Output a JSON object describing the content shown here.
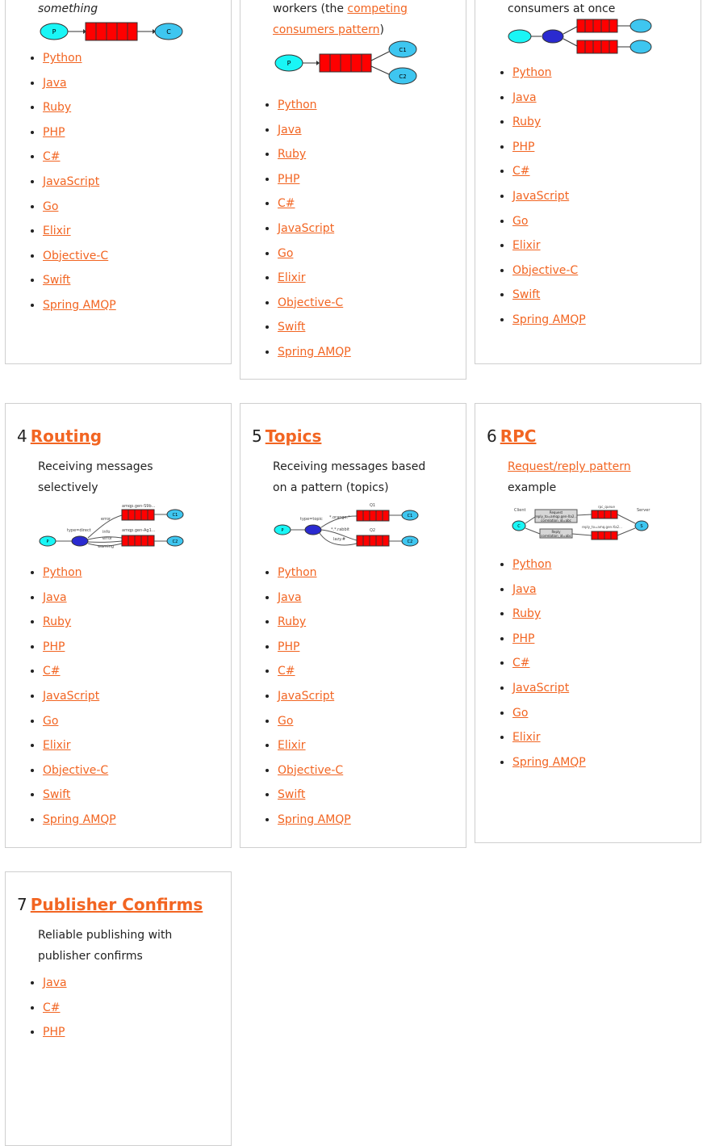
{
  "colors": {
    "link": "#f26522",
    "border": "#cfcfcf",
    "queue": "#ff0000",
    "node": "#3ec6f0"
  },
  "tutorials": [
    {
      "id": "1",
      "number": "",
      "title": "",
      "desc_pre": "something",
      "desc_link": "",
      "desc_post": "",
      "desc_italic": true,
      "languages": [
        "Python",
        "Java",
        "Ruby",
        "PHP",
        "C#",
        "JavaScript",
        "Go",
        "Elixir",
        "Objective-C",
        "Swift",
        "Spring AMQP"
      ]
    },
    {
      "id": "2",
      "number": "",
      "title": "",
      "desc_pre": "workers (the ",
      "desc_link": "competing consumers pattern",
      "desc_post": ")",
      "desc_italic": false,
      "languages": [
        "Python",
        "Java",
        "Ruby",
        "PHP",
        "C#",
        "JavaScript",
        "Go",
        "Elixir",
        "Objective-C",
        "Swift",
        "Spring AMQP"
      ]
    },
    {
      "id": "3",
      "number": "",
      "title": "",
      "desc_pre": "consumers at once",
      "desc_link": "",
      "desc_post": "",
      "desc_italic": false,
      "languages": [
        "Python",
        "Java",
        "Ruby",
        "PHP",
        "C#",
        "JavaScript",
        "Go",
        "Elixir",
        "Objective-C",
        "Swift",
        "Spring AMQP"
      ]
    },
    {
      "id": "4",
      "number": "4",
      "title": "Routing",
      "desc_pre": "Receiving messages selectively",
      "desc_link": "",
      "desc_post": "",
      "desc_italic": false,
      "languages": [
        "Python",
        "Java",
        "Ruby",
        "PHP",
        "C#",
        "JavaScript",
        "Go",
        "Elixir",
        "Objective-C",
        "Swift",
        "Spring AMQP"
      ]
    },
    {
      "id": "5",
      "number": "5",
      "title": "Topics",
      "desc_pre": "Receiving messages based on a pattern (topics)",
      "desc_link": "",
      "desc_post": "",
      "desc_italic": false,
      "languages": [
        "Python",
        "Java",
        "Ruby",
        "PHP",
        "C#",
        "JavaScript",
        "Go",
        "Elixir",
        "Objective-C",
        "Swift",
        "Spring AMQP"
      ]
    },
    {
      "id": "6",
      "number": "6",
      "title": "RPC",
      "desc_pre": "",
      "desc_link": "Request/reply pattern",
      "desc_post": " example",
      "desc_italic": false,
      "languages": [
        "Python",
        "Java",
        "Ruby",
        "PHP",
        "C#",
        "JavaScript",
        "Go",
        "Elixir",
        "Spring AMQP"
      ]
    },
    {
      "id": "7",
      "number": "7",
      "title": "Publisher Confirms",
      "desc_pre": "Reliable publishing with publisher confirms",
      "desc_link": "",
      "desc_post": "",
      "desc_italic": false,
      "languages": [
        "Java",
        "C#",
        "PHP"
      ]
    }
  ],
  "diagrams": {
    "d1": {
      "producer": "P",
      "consumer": "C"
    },
    "d2": {
      "producer": "P",
      "consumer1": "C1",
      "consumer2": "C2"
    },
    "d4": {
      "producer": "P",
      "exchange": "X",
      "type": "type=direct",
      "queue1": "amqp.gen-S9b...",
      "queue2": "amqp.gen-Ag1...",
      "binding1": "error",
      "binding2": "info",
      "binding3": "error",
      "binding4": "warning",
      "consumer1": "C1",
      "consumer2": "C2"
    },
    "d5": {
      "producer": "P",
      "exchange": "X",
      "type": "type=topic",
      "queue1": "Q1",
      "queue2": "Q2",
      "binding1": "*.orange.*",
      "binding2": "*.*.rabbit",
      "binding3": "lazy.#",
      "consumer1": "C1",
      "consumer2": "C2"
    },
    "d6": {
      "client": "Client",
      "server": "Server",
      "client_node": "C",
      "server_node": "S",
      "rpc_queue": "rpc_queue",
      "reply_queue": "reply_to=amq.gen-Xa2...",
      "request_box_line1": "Request",
      "request_box_line2": "reply_to=amqp.gen-Xa2...",
      "request_box_line3": "correlation_id=abc",
      "reply_box_line1": "Reply",
      "reply_box_line2": "correlation_id=abc"
    }
  }
}
